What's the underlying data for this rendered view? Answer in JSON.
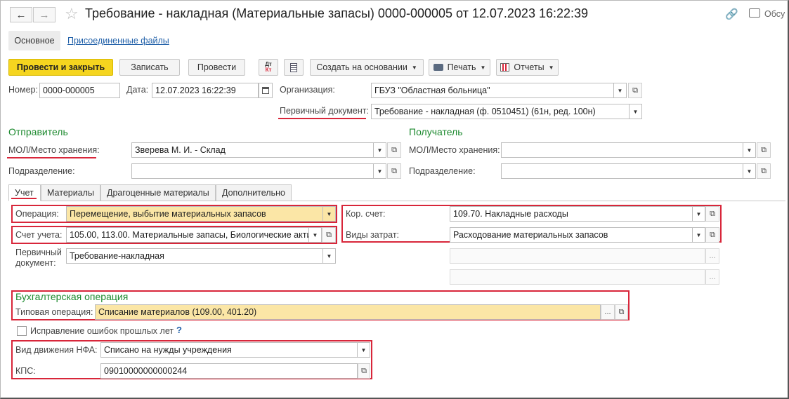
{
  "window": {
    "title": "Требование - накладная (Материальные запасы) 0000-000005 от 12.07.2023 16:22:39",
    "discuss_label": "Обсу"
  },
  "tabs": {
    "main": "Основное",
    "attached": "Присоединенные файлы"
  },
  "toolbar": {
    "post_close": "Провести и закрыть",
    "write": "Записать",
    "post": "Провести",
    "dt_kt": "Дт\nКт",
    "create_basis": "Создать на основании",
    "print": "Печать",
    "reports": "Отчеты"
  },
  "header": {
    "number_label": "Номер:",
    "number_value": "0000-000005",
    "date_label": "Дата:",
    "date_value": "12.07.2023 16:22:39",
    "org_label": "Организация:",
    "org_value": "ГБУЗ \"Областная больница\"",
    "primary_doc_label": "Первичный документ:",
    "primary_doc_value": "Требование - накладная (ф. 0510451) (61н, ред. 100н)"
  },
  "sender": {
    "title": "Отправитель",
    "mol_label": "МОЛ/Место хранения:",
    "mol_value": "Зверева М. И. - Склад",
    "dept_label": "Подразделение:",
    "dept_value": ""
  },
  "receiver": {
    "title": "Получатель",
    "mol_label": "МОЛ/Место хранения:",
    "mol_value": "",
    "dept_label": "Подразделение:",
    "dept_value": ""
  },
  "subtabs": [
    "Учет",
    "Материалы",
    "Драгоценные материалы",
    "Дополнительно"
  ],
  "accounting": {
    "operation_label": "Операция:",
    "operation_value": "Перемещение, выбытие материальных запасов",
    "account_label": "Счет учета:",
    "account_value": "105.00, 113.00. Материальные запасы, Биологические акти",
    "primary_label_1": "Первичный",
    "primary_label_2": "документ:",
    "primary_value": "Требование-накладная",
    "kor_label": "Кор. счет:",
    "kor_value": "109.70. Накладные расходы",
    "cost_label": "Виды затрат:",
    "cost_value": "Расходование материальных запасов"
  },
  "buh": {
    "title": "Бухгалтерская операция",
    "typical_label": "Типовая операция:",
    "typical_value": "Списание материалов (109.00, 401.20)"
  },
  "fix_errors_label": "Исправление ошибок прошлых лет",
  "help_mark": "?",
  "nfa": {
    "move_label": "Вид движения НФА:",
    "move_value": "Списано на нужды учреждения",
    "kps_label": "КПС:",
    "kps_value": "09010000000000244"
  },
  "ellipsis": "..."
}
